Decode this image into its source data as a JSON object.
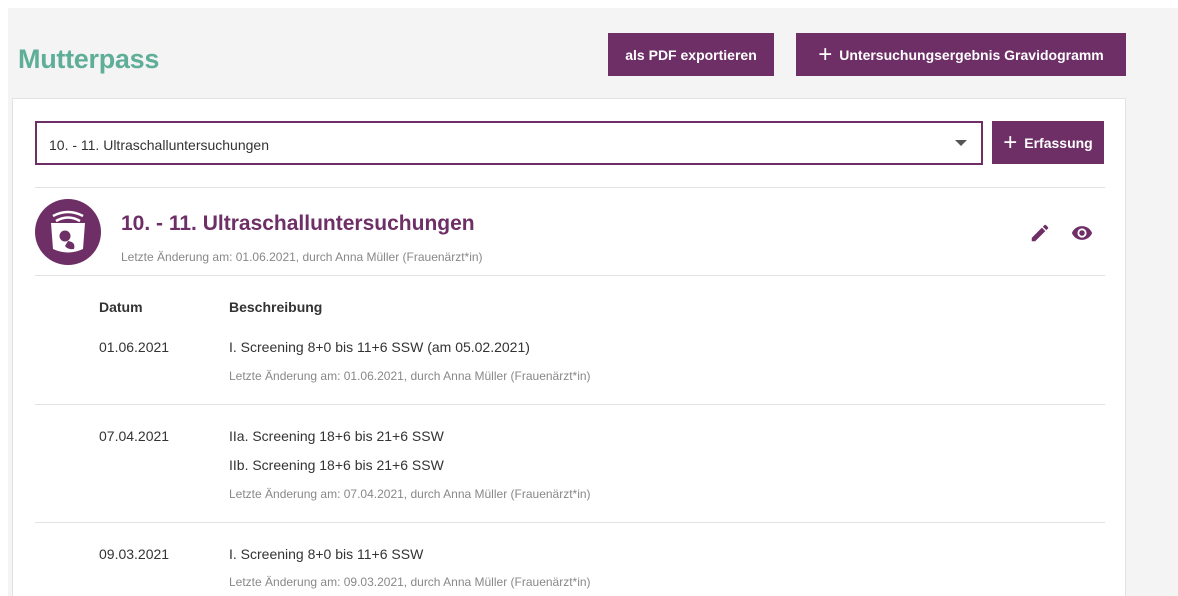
{
  "header": {
    "title": "Mutterpass",
    "export_label": "als PDF exportieren",
    "gravidogramm_label": "Untersuchungsergebnis Gravidogramm"
  },
  "selector": {
    "value": "10. - 11. Ultraschalluntersuchungen",
    "erfassung_label": "Erfassung"
  },
  "section": {
    "title": "10. - 11. Ultraschalluntersuchungen",
    "meta": "Letzte Änderung am: 01.06.2021, durch Anna Müller (Frauenärzt*in)"
  },
  "table": {
    "col_date": "Datum",
    "col_desc": "Beschreibung",
    "rows": [
      {
        "date": "01.06.2021",
        "lines": [
          "I. Screening 8+0 bis 11+6 SSW (am 05.02.2021)"
        ],
        "meta": "Letzte Änderung am: 01.06.2021, durch Anna Müller (Frauenärzt*in)"
      },
      {
        "date": "07.04.2021",
        "lines": [
          "IIa. Screening 18+6 bis 21+6 SSW",
          "IIb. Screening 18+6 bis 21+6 SSW"
        ],
        "meta": "Letzte Änderung am: 07.04.2021, durch Anna Müller (Frauenärzt*in)"
      },
      {
        "date": "09.03.2021",
        "lines": [
          "I. Screening 8+0 bis 11+6 SSW"
        ],
        "meta": "Letzte Änderung am: 09.03.2021, durch Anna Müller (Frauenärzt*in)"
      }
    ]
  },
  "icons": {
    "ultrasound": "ultrasound-icon",
    "edit": "pencil-icon",
    "view": "eye-icon",
    "plus": "plus-icon",
    "caret": "chevron-down-icon"
  },
  "colors": {
    "brand_purple": "#6e2e66",
    "title_green": "#5fae97"
  }
}
